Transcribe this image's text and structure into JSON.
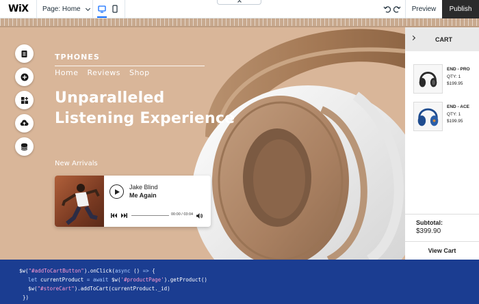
{
  "editor": {
    "logo": "WiX",
    "page_selector": "Page: Home",
    "preview_label": "Preview",
    "publish_label": "Publish"
  },
  "site": {
    "brand": "TPHONES",
    "nav": [
      "Home",
      "Reviews",
      "Shop"
    ],
    "hero_line1": "Unparalleled",
    "hero_line2": "Listening Experience",
    "section_label": "New Arrivals",
    "player": {
      "artist": "Jake Blind",
      "track": "Me Again",
      "time": "00:00 / 03:04"
    }
  },
  "cart": {
    "title": "CART",
    "items": [
      {
        "name": "END - PRO",
        "qty": "QTY: 1",
        "price": "$199.95"
      },
      {
        "name": "END - ACE",
        "qty": "QTY: 1",
        "price": "$199.95"
      }
    ],
    "subtotal_label": "Subtotal:",
    "subtotal_value": "$399.90",
    "view_cart": "View Cart"
  },
  "code": {
    "l1_a": "$w(",
    "l1_b": "\"#addToCartButton\"",
    "l1_c": ").onClick(",
    "l1_d": "async",
    "l1_e": " () ",
    "l1_f": "=>",
    "l1_g": " {",
    "l2_a": "let",
    "l2_b": " currentProduct ",
    "l2_c": "=",
    "l2_d": " ",
    "l2_e": "await",
    "l2_f": " $w(",
    "l2_g": "'#productPage'",
    "l2_h": ").getProduct()",
    "l3_a": "$w(",
    "l3_b": "\"#storeCart\"",
    "l3_c": ").addToCart(currentProduct._id)",
    "l4": "})"
  },
  "colors": {
    "canvas_bg": "#d9b699",
    "code_bg": "#1b3d91",
    "publish_bg": "#2b2b2b",
    "accent_blue": "#116dff"
  }
}
